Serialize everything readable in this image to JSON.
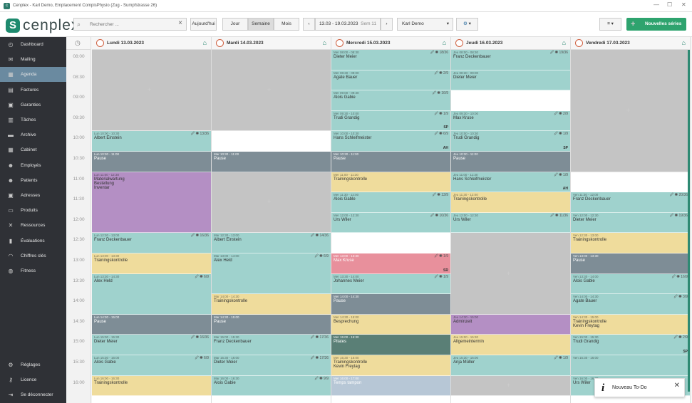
{
  "window": {
    "title": "Cenplex - Karl Demo, Emplacement CompisPhysio (Zug - Sumpfstrasse 26)"
  },
  "header": {
    "logo": "cenplex",
    "search_placeholder": "Rechercher ...",
    "today": "Aujourd'hui",
    "view_day": "Jour",
    "view_week": "Semaine",
    "view_month": "Mois",
    "range": "13.03 - 19.03.2023",
    "week": "Sem 11",
    "user": "Karl Demo",
    "new_series": "Nouvelles séries"
  },
  "sidebar": {
    "items": [
      {
        "label": "Dashboard",
        "icon": "dashboard-icon"
      },
      {
        "label": "Mailing",
        "icon": "mail-icon"
      },
      {
        "label": "Agenda",
        "icon": "calendar-icon"
      },
      {
        "label": "Factures",
        "icon": "invoice-icon"
      },
      {
        "label": "Garanties",
        "icon": "guarantee-icon"
      },
      {
        "label": "Tâches",
        "icon": "task-icon"
      },
      {
        "label": "Archive",
        "icon": "archive-icon"
      },
      {
        "label": "Cabinet",
        "icon": "building-icon"
      },
      {
        "label": "Employés",
        "icon": "employees-icon"
      },
      {
        "label": "Patients",
        "icon": "patients-icon"
      },
      {
        "label": "Adresses",
        "icon": "address-icon"
      },
      {
        "label": "Produits",
        "icon": "products-icon"
      },
      {
        "label": "Ressources",
        "icon": "resources-icon"
      },
      {
        "label": "Évaluations",
        "icon": "chart-icon"
      },
      {
        "label": "Chiffres clés",
        "icon": "gauge-icon"
      },
      {
        "label": "Fitness",
        "icon": "fitness-icon"
      }
    ],
    "bottom": [
      {
        "label": "Réglages",
        "icon": "gear-icon"
      },
      {
        "label": "Licence",
        "icon": "key-icon"
      },
      {
        "label": "Se déconnecter",
        "icon": "logout-icon"
      }
    ]
  },
  "times": [
    "08:00",
    "08:30",
    "09:00",
    "09:30",
    "10:00",
    "10:30",
    "11:00",
    "11:30",
    "12:00",
    "12:30",
    "13:00",
    "13:30",
    "14:00",
    "14:30",
    "15:00",
    "15:30",
    "16:00"
  ],
  "days": [
    {
      "label": "Lundi 13.03.2023",
      "events": [
        {
          "s": 4,
          "d": 1,
          "c": "bteal",
          "t": "Lun 10:00 - 10:30",
          "n": "Albert Einstein",
          "i": "13/36"
        },
        {
          "s": 5,
          "d": 1,
          "c": "bslate",
          "t": "Lun 10:30 - 11:00",
          "n": "Pause",
          "light": 1
        },
        {
          "s": 6,
          "d": 3,
          "c": "bpurple",
          "t": "Lun 11:00 - 12:30",
          "n": "Materialwartung",
          "n2": "Bestellung",
          "n3": "Inventar"
        },
        {
          "s": 9,
          "d": 1,
          "c": "bteal",
          "t": "Lun 12:30 - 13:00",
          "n": "Franz Deckenbauer",
          "i": "16/36"
        },
        {
          "s": 10,
          "d": 1,
          "c": "byellow",
          "t": "Lun 13:00 - 13:30",
          "n": "Trainingskontrolle"
        },
        {
          "s": 11,
          "d": 2,
          "c": "bteal",
          "t": "Lun 13:30 - 14:30",
          "n": "Alex Held",
          "i": "6/9"
        },
        {
          "s": 13,
          "d": 1,
          "c": "bslate",
          "t": "Lun 14:30 - 15:00",
          "n": "Pause",
          "light": 1
        },
        {
          "s": 14,
          "d": 1,
          "c": "bteal",
          "t": "Lun 15:00 - 15:30",
          "n": "Dieter Meier",
          "i": "16/36"
        },
        {
          "s": 15,
          "d": 1,
          "c": "bteal",
          "t": "Lun 15:30 - 16:00",
          "n": "Alois Gabie",
          "i": "6/9"
        },
        {
          "s": 16,
          "d": 1,
          "c": "byellow",
          "t": "Lun 16:00 - 16:30",
          "n": "Trainingskontrolle"
        }
      ],
      "grays": [
        [
          0,
          4
        ]
      ]
    },
    {
      "label": "Mardi 14.03.2023",
      "events": [
        {
          "s": 5,
          "d": 1,
          "c": "bslate",
          "t": "Mar 10:30 - 11:00",
          "n": "Pause",
          "light": 1
        },
        {
          "s": 9,
          "d": 1,
          "c": "bteal",
          "t": "Mar 12:30 - 13:00",
          "n": "Albert Einstein",
          "i": "14/36"
        },
        {
          "s": 10,
          "d": 2,
          "c": "bteal",
          "t": "Mar 13:00 - 14:00",
          "n": "Alex Held",
          "i": "6/9"
        },
        {
          "s": 12,
          "d": 1,
          "c": "byellow",
          "t": "Mar 14:00 - 14:30",
          "n": "Trainingskontrolle"
        },
        {
          "s": 13,
          "d": 1,
          "c": "bslate",
          "t": "Mar 14:30 - 15:00",
          "n": "Pause",
          "light": 1
        },
        {
          "s": 14,
          "d": 1,
          "c": "bteal",
          "t": "Mar 15:00 - 15:30",
          "n": "Franz Deckenbauer",
          "i": "17/36"
        },
        {
          "s": 15,
          "d": 1,
          "c": "bteal",
          "t": "Mar 15:30 - 16:00",
          "n": "Dieter Meier",
          "i": "17/36"
        },
        {
          "s": 16,
          "d": 1,
          "c": "bteal",
          "t": "Mar 16:00 - 16:30",
          "n": "Alois Gabie",
          "i": "9/9"
        }
      ],
      "grays": [
        [
          0,
          4
        ],
        [
          6,
          3
        ]
      ]
    },
    {
      "label": "Mercredi 15.03.2023",
      "events": [
        {
          "s": 0,
          "d": 1,
          "c": "bteal",
          "t": "Mer 08:00 - 08:30",
          "n": "Dieter Meier",
          "i": "18/36"
        },
        {
          "s": 1,
          "d": 1,
          "c": "bteal",
          "t": "Mer 08:30 - 09:00",
          "n": "Agate Bauer",
          "i": "2/9"
        },
        {
          "s": 2,
          "d": 1,
          "c": "bteal",
          "t": "Mer 09:00 - 09:30",
          "n": "Alois Gabie",
          "i": "16/9"
        },
        {
          "s": 3,
          "d": 1,
          "c": "bteal",
          "t": "Mer 09:30 - 10:00",
          "n": "Trudi Grandig",
          "i": "1/9",
          "tag": "SP"
        },
        {
          "s": 4,
          "d": 1,
          "c": "bteal",
          "t": "Mer 10:00 - 10:30",
          "n": "Hans Schleifmeister",
          "i": "6/9",
          "tag": "AH"
        },
        {
          "s": 5,
          "d": 1,
          "c": "bslate",
          "t": "Mer 10:30 - 11:00",
          "n": "Pause",
          "light": 1
        },
        {
          "s": 6,
          "d": 1,
          "c": "byellow",
          "t": "Mer 11:00 - 11:30",
          "n": "Trainingskontrolle"
        },
        {
          "s": 7,
          "d": 1,
          "c": "bteal",
          "t": "Mer 11:30 - 12:00",
          "n": "Alois Gable",
          "i": "13/9"
        },
        {
          "s": 8,
          "d": 1,
          "c": "bteal",
          "t": "Mer 12:00 - 12:30",
          "n": "Urs Wiler",
          "i": "10/36"
        },
        {
          "s": 10,
          "d": 1,
          "c": "bpink",
          "t": "Mer 13:00 - 13:30",
          "n": "Max Kruse",
          "i": "1/9",
          "tag": "SR",
          "light": 1
        },
        {
          "s": 11,
          "d": 1,
          "c": "bteal",
          "t": "Mer 13:30 - 14:00",
          "n": "Johannes Meier",
          "i": "1/9"
        },
        {
          "s": 12,
          "d": 1,
          "c": "bslate",
          "t": "Mer 14:00 - 14:30",
          "n": "Pause",
          "light": 1
        },
        {
          "s": 13,
          "d": 1,
          "c": "byellow",
          "t": "Mer 14:30 - 15:00",
          "n": "Besprechung"
        },
        {
          "s": 14,
          "d": 1,
          "c": "bdteal",
          "t": "Mer 15:00 - 15:30",
          "n": "Pilates",
          "light": 1
        },
        {
          "s": 15,
          "d": 1,
          "c": "byellow",
          "t": "Mer 15:30 - 16:00",
          "n": "Trainingskontrolle",
          "n2": "Kevin Freytag"
        },
        {
          "s": 16,
          "d": 1,
          "c": "bblue",
          "t": "Mer 16:00 - 17:00",
          "n": "Temps tampon",
          "light": 1
        }
      ],
      "grays": []
    },
    {
      "label": "Jeudi 16.03.2023",
      "events": [
        {
          "s": 0,
          "d": 1,
          "c": "bteal",
          "t": "Jeu 08:00 - 08:30",
          "n": "Franz Deckenbauer",
          "i": "19/36"
        },
        {
          "s": 1,
          "d": 1,
          "c": "bteal",
          "t": "Jeu 08:30 - 09:00",
          "n": "Dieter Meier"
        },
        {
          "s": 3,
          "d": 1,
          "c": "bteal",
          "t": "Jeu 09:30 - 10:00",
          "n": "Max Kruse",
          "i": "2/9"
        },
        {
          "s": 4,
          "d": 1,
          "c": "bteal",
          "t": "Jeu 10:00 - 10:30",
          "n": "Trudi Grandig",
          "i": "1/9",
          "tag": "SP"
        },
        {
          "s": 5,
          "d": 1,
          "c": "bslate",
          "t": "Jeu 10:30 - 11:00",
          "n": "Pause",
          "light": 1
        },
        {
          "s": 6,
          "d": 1,
          "c": "bteal",
          "t": "Jeu 11:00 - 11:30",
          "n": "Hans Schleifmeister",
          "i": "1/9",
          "tag": "AH"
        },
        {
          "s": 7,
          "d": 1,
          "c": "byellow",
          "t": "Jeu 11:30 - 12:00",
          "n": "Trainingskontrolle"
        },
        {
          "s": 8,
          "d": 1,
          "c": "bteal",
          "t": "Jeu 12:00 - 12:30",
          "n": "Urs Wiler",
          "i": "11/36"
        },
        {
          "s": 13,
          "d": 1,
          "c": "bpurple",
          "t": "Jeu 14:30 - 15:00",
          "n": "Adminzeit"
        },
        {
          "s": 14,
          "d": 1,
          "c": "byellow",
          "t": "Jeu 15:00 - 15:30",
          "n": "Allgemeintermin"
        },
        {
          "s": 15,
          "d": 1,
          "c": "bteal",
          "t": "Jeu 15:30 - 16:00",
          "n": "Anja Müller",
          "i": "1/9"
        }
      ],
      "grays": [
        [
          9,
          4
        ],
        [
          16,
          1
        ]
      ]
    },
    {
      "label": "Vendredi 17.03.2023",
      "events": [
        {
          "s": 7,
          "d": 1,
          "c": "bteal",
          "t": "Ven 11:30 - 12:00",
          "n": "Franz Deckenbauer",
          "i": "20/36"
        },
        {
          "s": 8,
          "d": 1,
          "c": "bteal",
          "t": "Ven 12:00 - 12:30",
          "n": "Dieter Meier",
          "i": "19/36"
        },
        {
          "s": 9,
          "d": 1,
          "c": "byellow",
          "t": "Ven 12:30 - 13:00",
          "n": "Trainingskontrolle"
        },
        {
          "s": 10,
          "d": 1,
          "c": "bslate",
          "t": "Ven 13:00 - 13:30",
          "n": "Pause",
          "light": 1
        },
        {
          "s": 11,
          "d": 1,
          "c": "bteal",
          "t": "Ven 13:30 - 14:00",
          "n": "Alois Gable",
          "i": "16/9"
        },
        {
          "s": 12,
          "d": 1,
          "c": "bteal",
          "t": "Ven 14:00 - 14:30",
          "n": "Agate Bauer",
          "i": "3/9"
        },
        {
          "s": 13,
          "d": 1,
          "c": "byellow",
          "t": "Ven 14:30 - 15:00",
          "n": "Trainingskontrolle",
          "n2": "Kevin Freytag"
        },
        {
          "s": 14,
          "d": 1,
          "c": "bteal",
          "t": "Ven 15:00 - 15:30",
          "n": "Trudi Grandig",
          "i": "2/9",
          "tag": "SP"
        },
        {
          "s": 15,
          "d": 1,
          "c": "bteal",
          "t": "Ven 15:30 - 16:00",
          "n": ""
        },
        {
          "s": 16,
          "d": 1,
          "c": "bteal",
          "t": "Ven 16:00 - 16:30",
          "n": "Urs Wiler"
        }
      ],
      "grays": [
        [
          0,
          6
        ]
      ]
    }
  ],
  "todo": {
    "label": "Nouveau To-Do"
  }
}
